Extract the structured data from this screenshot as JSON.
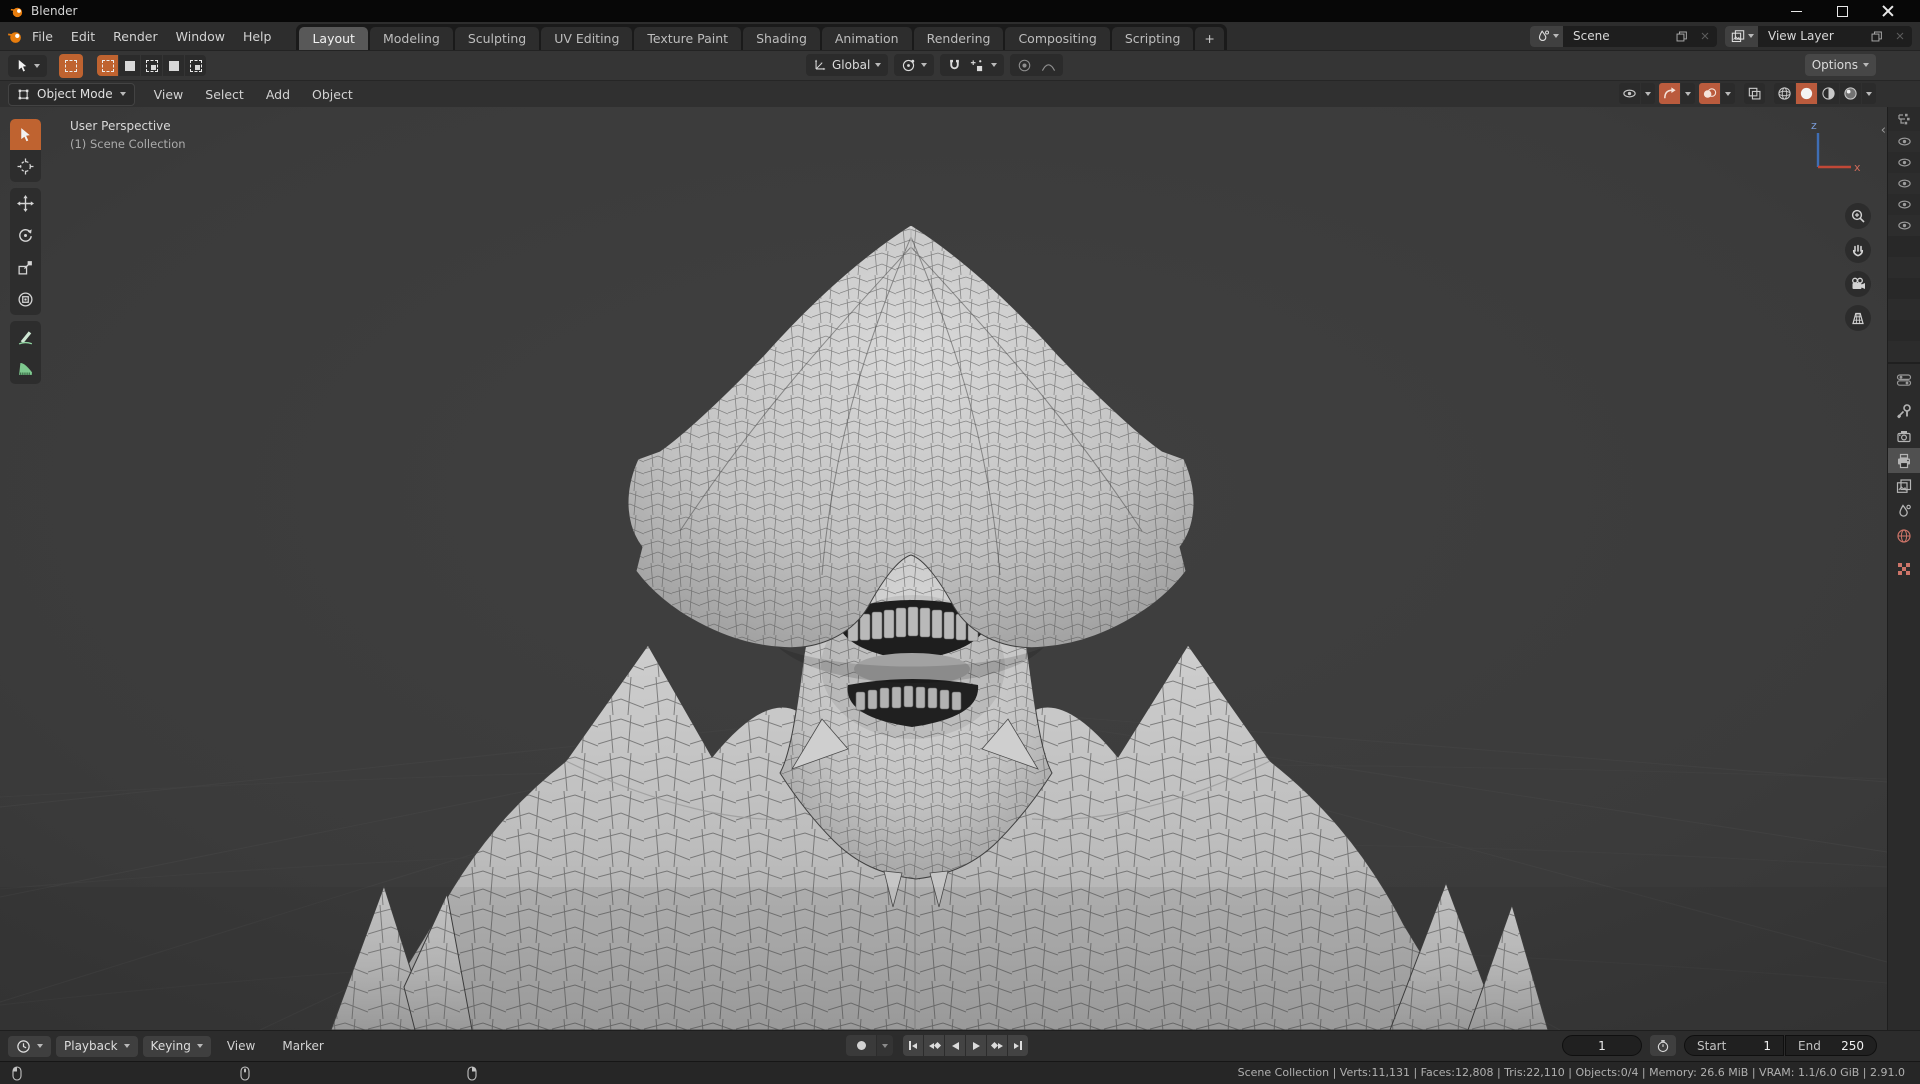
{
  "window": {
    "title": "Blender"
  },
  "topbar": {
    "menus": [
      "File",
      "Edit",
      "Render",
      "Window",
      "Help"
    ],
    "tabs": [
      "Layout",
      "Modeling",
      "Sculpting",
      "UV Editing",
      "Texture Paint",
      "Shading",
      "Animation",
      "Rendering",
      "Compositing",
      "Scripting"
    ],
    "active_tab": "Layout",
    "add_tab": "+",
    "scene_name": "Scene",
    "view_layer_name": "View Layer"
  },
  "tool_settings": {
    "orientation": "Global",
    "options": "Options"
  },
  "viewport_header": {
    "mode": "Object Mode",
    "menus": [
      "View",
      "Select",
      "Add",
      "Object"
    ]
  },
  "viewport": {
    "overlay_line1": "User Perspective",
    "overlay_line2": "(1) Scene Collection",
    "axis_x": "x",
    "axis_z": "z"
  },
  "left_toolbar": {
    "tools": [
      "select-box",
      "cursor",
      "move",
      "rotate",
      "scale",
      "transform",
      "annotate",
      "measure"
    ],
    "active_tool": "select-box"
  },
  "right_rail": {
    "outliner_visibility_rows": 5,
    "properties_tabs": [
      "tool",
      "render",
      "output",
      "view-layer",
      "scene",
      "world",
      "texture"
    ],
    "active_properties_tab": "output"
  },
  "timeline": {
    "menus": [
      "Playback",
      "Keying",
      "View",
      "Marker"
    ],
    "current_frame": "1",
    "start_label": "Start",
    "start_value": "1",
    "end_label": "End",
    "end_value": "250"
  },
  "status_bar": {
    "stats": "Scene Collection | Verts:11,131 | Faces:12,808 | Tris:22,110 | Objects:0/4 | Memory: 26.6 MiB | VRAM: 1.1/6.0 GiB | 2.91.0"
  },
  "colors": {
    "accent": "#e87d0d",
    "active_tool_bg": "#bf6330",
    "toggle_orange": "#ba5b3d",
    "axis_x": "#c14837",
    "axis_z": "#3f6eb5"
  }
}
